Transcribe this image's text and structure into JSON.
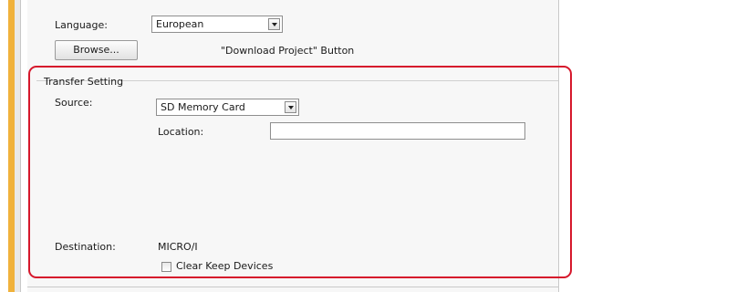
{
  "language": {
    "label": "Language:",
    "value": "European"
  },
  "browse": {
    "label": "Browse...",
    "description": "\"Download Project\" Button"
  },
  "transfer_setting": {
    "title": "Transfer Setting",
    "source": {
      "label": "Source:",
      "value": "SD Memory Card"
    },
    "location": {
      "label": "Location:",
      "value": ""
    },
    "destination": {
      "label": "Destination:",
      "value": "MICRO/I"
    },
    "clear_keep": {
      "label": "Clear Keep Devices",
      "checked": false
    }
  },
  "highlight_color": "#d6182c",
  "accent_color": "#f0b23c"
}
